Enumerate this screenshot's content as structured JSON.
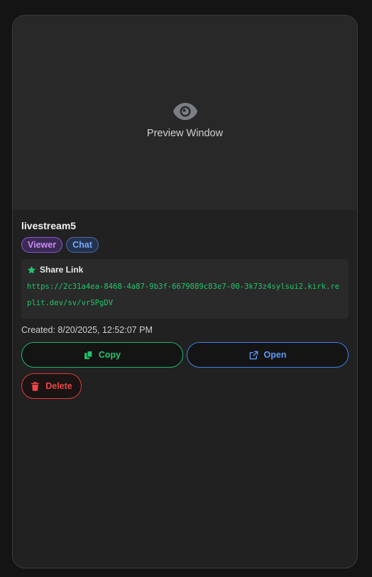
{
  "preview": {
    "label": "Preview Window",
    "icon": "eye-icon"
  },
  "stream": {
    "name": "livestream5",
    "badges": [
      "Viewer",
      "Chat"
    ],
    "share": {
      "title": "Share Link",
      "url": "https://2c31a4ea-8468-4a87-9b3f-6679889c83e7-00-3k73z4sylsui2.kirk.replit.dev/sv/vrSPgDV"
    },
    "created": "Created: 8/20/2025, 12:52:07 PM"
  },
  "actions": {
    "copy": "Copy",
    "open": "Open",
    "delete": "Delete"
  },
  "colors": {
    "viewer": "#c88cf5",
    "chat": "#7aaaf5",
    "copy": "#22c56a",
    "open": "#5b9af5",
    "delete": "#f04444"
  }
}
